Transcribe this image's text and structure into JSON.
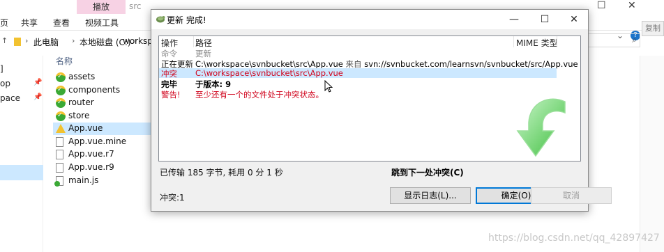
{
  "explorer": {
    "context_tab": "播放",
    "path_fragment": "src",
    "ribbon_tabs": [
      "页",
      "共享",
      "查看",
      "视频工具"
    ],
    "breadcrumb": [
      "此电脑",
      "本地磁盘 (C:)",
      "workspa"
    ],
    "copy_button": "复制",
    "left_pane_items": [
      "]",
      "op",
      "pace"
    ],
    "column_header": "名称",
    "files": [
      {
        "name": "assets",
        "icon": "svn-ok-folder-icon"
      },
      {
        "name": "components",
        "icon": "svn-ok-folder-icon"
      },
      {
        "name": "router",
        "icon": "svn-ok-folder-icon"
      },
      {
        "name": "store",
        "icon": "svn-ok-folder-icon"
      },
      {
        "name": "App.vue",
        "icon": "svn-conflict-icon"
      },
      {
        "name": "App.vue.mine",
        "icon": "document-icon"
      },
      {
        "name": "App.vue.r7",
        "icon": "document-icon"
      },
      {
        "name": "App.vue.r9",
        "icon": "document-icon"
      },
      {
        "name": "main.js",
        "icon": "svn-ok-js-icon"
      }
    ],
    "watermark": "https://blog.csdn.net/qq_42897427"
  },
  "dialog": {
    "title": "更新 完成!",
    "headers": {
      "action": "操作",
      "path": "路径",
      "mime": "MIME 类型"
    },
    "rows": [
      {
        "action": "命令",
        "path": "更新",
        "style": "gray"
      },
      {
        "action": "正在更新",
        "path": "C:\\workspace\\svnbucket\\src\\App.vue",
        "from_label": "来自",
        "from_url": "svn://svnbucket.com/learnsvn/svnbucket/src/App.vue",
        "style": "normal"
      },
      {
        "action": "冲突",
        "path": "C:\\workspace\\svnbucket\\src\\App.vue",
        "style": "red-highlight"
      },
      {
        "action": "完毕",
        "path": "于版本: 9",
        "style": "bold"
      },
      {
        "action": "警告!",
        "path": "至少还有一个的文件处于冲突状态。",
        "style": "red"
      }
    ],
    "status_left": "已传输 185 字节, 耗用 0 分 1 秒",
    "status_right": "跳到下一处冲突(C)",
    "conflict_count": "冲突:1",
    "buttons": {
      "show_log": "显示日志(L)...",
      "ok": "确定(O)",
      "cancel": "取消"
    }
  },
  "colors": {
    "accent": "#0078d7",
    "conflict_red": "#d0021b",
    "highlight": "#cce8ff",
    "arrow_green": "#5fcf5f"
  }
}
